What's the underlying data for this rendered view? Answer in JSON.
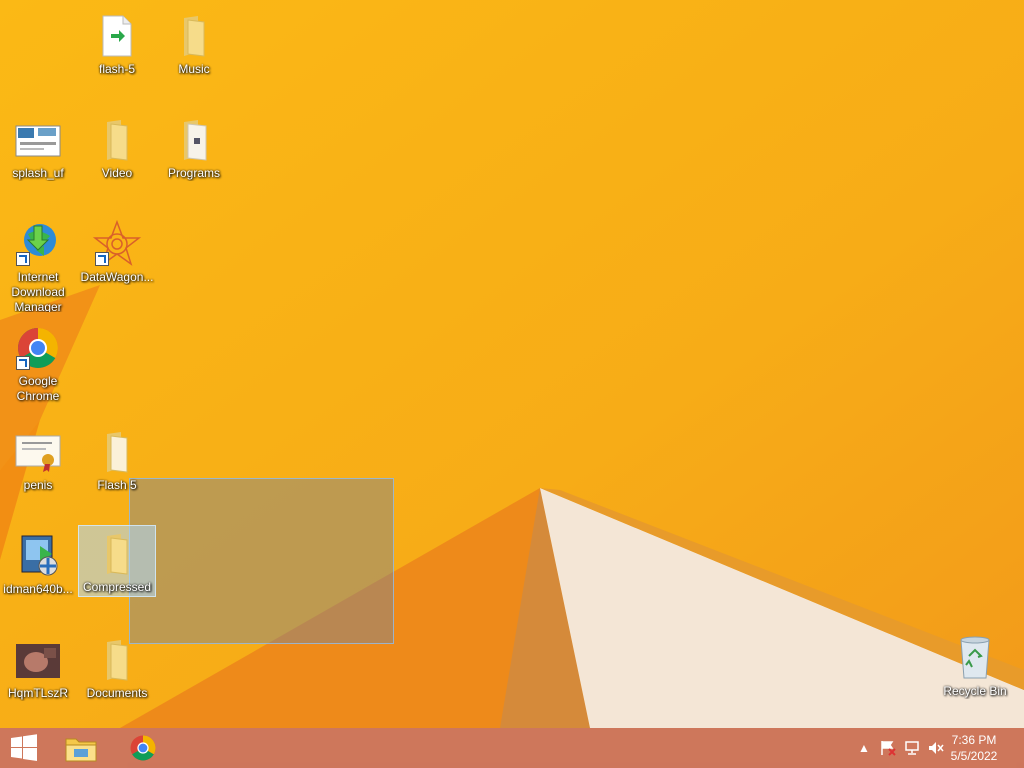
{
  "desktop": {
    "icons": [
      {
        "label": "flash-5"
      },
      {
        "label": "Music"
      },
      {
        "label": "splash_uf"
      },
      {
        "label": "Video"
      },
      {
        "label": "Programs"
      },
      {
        "label": "Internet Download Manager"
      },
      {
        "label": "DataWagon..."
      },
      {
        "label": "Google Chrome"
      },
      {
        "label": "penis"
      },
      {
        "label": "Flash 5"
      },
      {
        "label": "idman640b..."
      },
      {
        "label": "Compressed"
      },
      {
        "label": "HqmTLszR"
      },
      {
        "label": "Documents"
      },
      {
        "label": "Recycle Bin"
      }
    ]
  },
  "taskbar": {
    "start_icon": "windows-logo-icon",
    "pinned": [
      "file-explorer-icon",
      "chrome-icon"
    ],
    "tray_icons": [
      "show-hidden-icons-chevron",
      "action-center-flag-icon",
      "network-icon",
      "volume-muted-icon"
    ],
    "time": "7:36 PM",
    "date": "5/5/2022"
  },
  "colors": {
    "wallpaper": "#f5b01c",
    "taskbar": "#c86e64",
    "selection": "#adc8ff"
  }
}
